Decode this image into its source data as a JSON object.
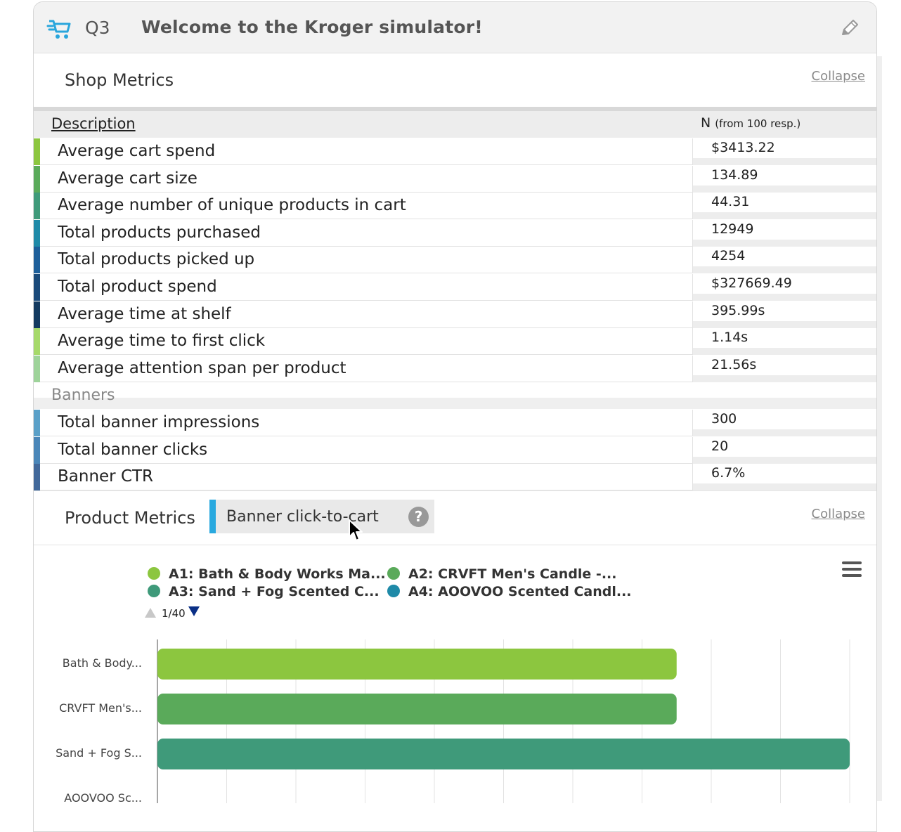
{
  "header": {
    "question": "Q3",
    "title": "Welcome to the Kroger simulator!"
  },
  "shop_metrics": {
    "title": "Shop Metrics",
    "collapse_label": "Collapse",
    "columns": {
      "description": "Description",
      "n": "N",
      "n_note": "(from 100 resp.)"
    },
    "rows": [
      {
        "label": "Average cart spend",
        "value": "$3413.22",
        "color": "#8cc63f"
      },
      {
        "label": "Average cart size",
        "value": "134.89",
        "color": "#5aaa5a"
      },
      {
        "label": "Average number of unique products in cart",
        "value": "44.31",
        "color": "#3f9a7a"
      },
      {
        "label": "Total products purchased",
        "value": "12949",
        "color": "#1f8aa8"
      },
      {
        "label": "Total products picked up",
        "value": "4254",
        "color": "#1d5f9a"
      },
      {
        "label": "Total product spend",
        "value": "$327669.49",
        "color": "#1a4a7a"
      },
      {
        "label": "Average time at shelf",
        "value": "395.99s",
        "color": "#133a60"
      },
      {
        "label": "Average time to first click",
        "value": "1.14s",
        "color": "#a6d96a"
      },
      {
        "label": "Average attention span per product",
        "value": "21.56s",
        "color": "#9ed39a"
      }
    ],
    "banners_label": "Banners",
    "banner_rows": [
      {
        "label": "Total banner impressions",
        "value": "300",
        "color": "#5aa0c8"
      },
      {
        "label": "Total banner clicks",
        "value": "20",
        "color": "#4a86b8"
      },
      {
        "label": "Banner CTR",
        "value": "6.7%",
        "color": "#41689a"
      }
    ]
  },
  "product_metrics": {
    "title": "Product Metrics",
    "collapse_label": "Collapse",
    "selected_metric": "Banner click-to-cart",
    "help_label": "?",
    "pager": "1/40",
    "legend": [
      {
        "label": "A1: Bath & Body Works Ma...",
        "color": "#8cc63f"
      },
      {
        "label": "A2: CRVFT Men's Candle -...",
        "color": "#5aaa5a"
      },
      {
        "label": "A3: Sand + Fog Scented C...",
        "color": "#3f9a7a"
      },
      {
        "label": "A4: AOOVOO Scented Candl...",
        "color": "#1f8aa8"
      }
    ]
  },
  "chart_data": {
    "type": "bar",
    "orientation": "horizontal",
    "categories": [
      "Bath & Body...",
      "CRVFT Men's...",
      "Sand + Fog S...",
      "AOOVOO Sc..."
    ],
    "values": [
      0.75,
      0.75,
      1.0,
      null
    ],
    "colors": [
      "#8cc63f",
      "#5aaa5a",
      "#3f9a7a",
      "#1f8aa8"
    ],
    "xlim": [
      0,
      1
    ],
    "grid": true
  }
}
